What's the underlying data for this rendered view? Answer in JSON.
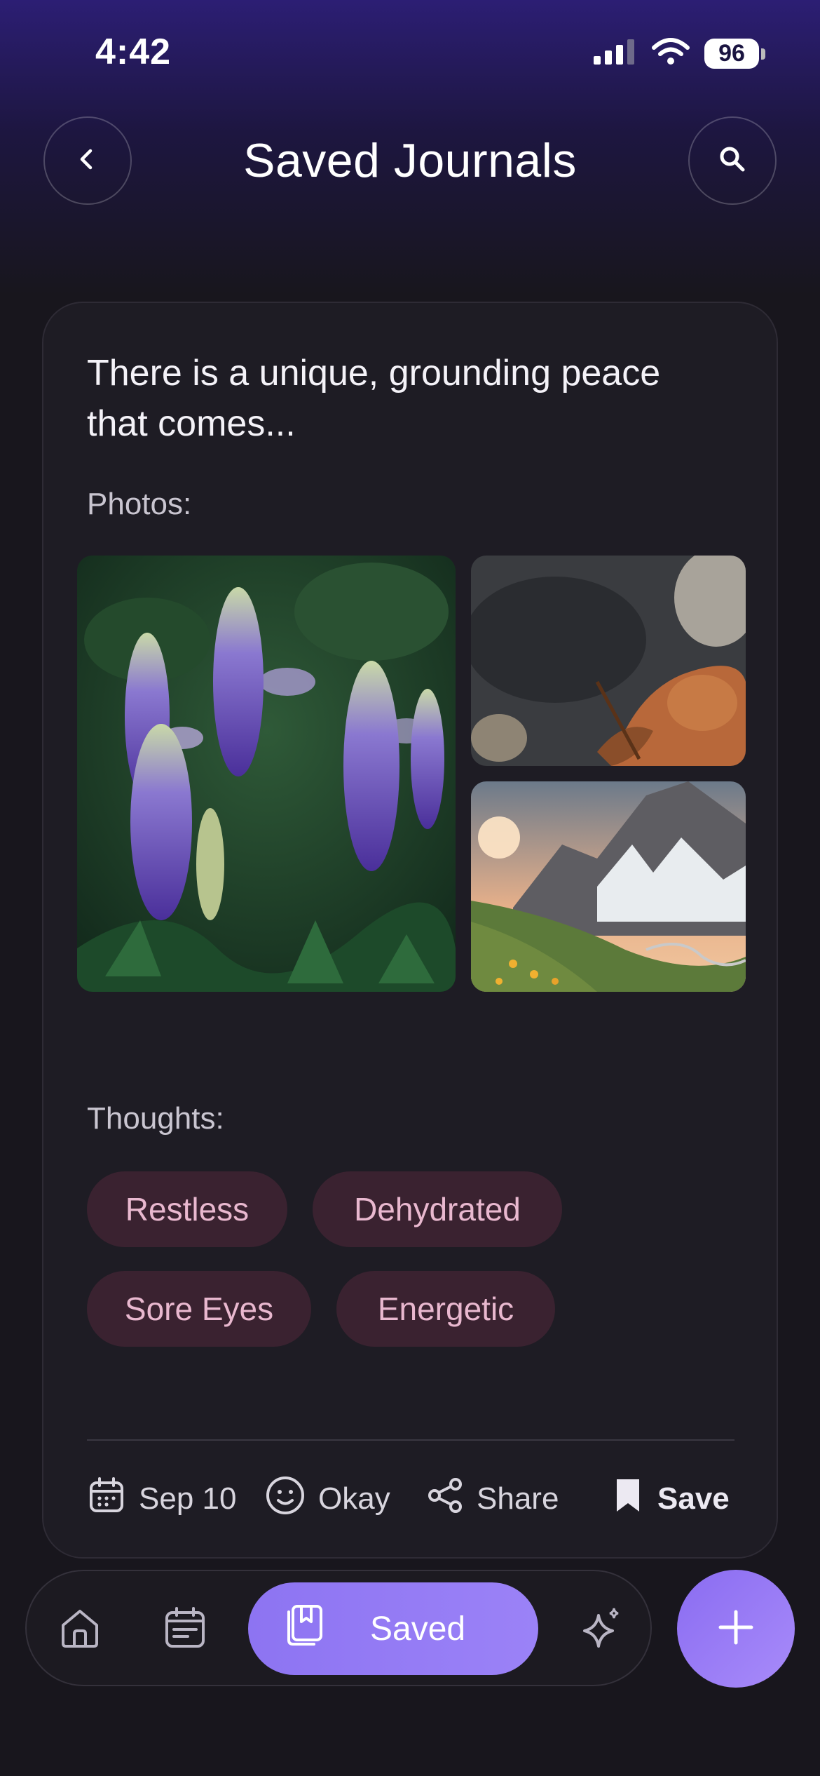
{
  "status_bar": {
    "time": "4:42",
    "battery": "96",
    "icons": [
      "signal-icon",
      "wifi-icon",
      "battery-icon"
    ]
  },
  "header": {
    "title": "Saved Journals",
    "back_icon": "chevron-left-icon",
    "search_icon": "search-icon"
  },
  "journal_card": {
    "excerpt": "There is a unique, grounding peace that comes...",
    "photos_label": "Photos:",
    "photos": [
      "lupine-flowers",
      "autumn-leaves-on-stones",
      "mountain-valley-sunset"
    ],
    "thoughts_label": "Thoughts:",
    "thoughts": [
      "Restless",
      "Dehydrated",
      "Sore Eyes",
      "Energetic"
    ],
    "meta": {
      "date": "Sep 10",
      "mood": "Okay",
      "share_label": "Share",
      "save_label": "Save"
    }
  },
  "bottom_nav": {
    "items": [
      {
        "icon": "home-icon"
      },
      {
        "icon": "calendar-list-icon"
      },
      {
        "icon": "bookmark-stack-icon",
        "label": "Saved",
        "active": true
      },
      {
        "icon": "sparkle-icon"
      }
    ],
    "fab_icon": "plus-icon"
  },
  "colors": {
    "accent": "#9b82f7",
    "chip_bg": "#3a2230",
    "chip_text": "#e9b8cf",
    "background": "#18161d"
  }
}
